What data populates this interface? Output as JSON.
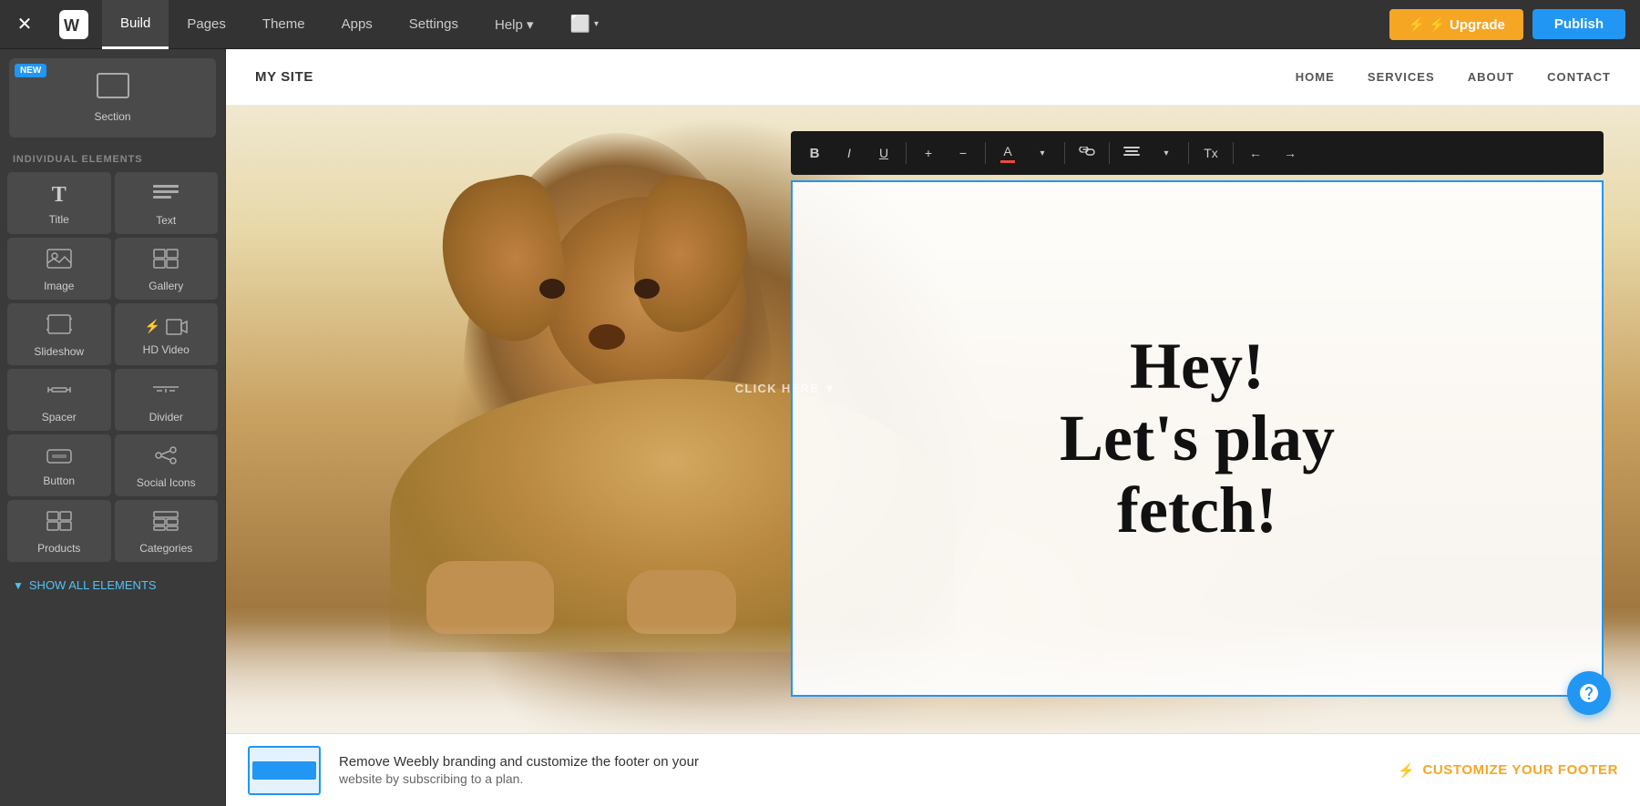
{
  "topbar": {
    "close_label": "×",
    "logo_alt": "Weebly Logo",
    "nav_items": [
      {
        "id": "build",
        "label": "Build",
        "active": true
      },
      {
        "id": "pages",
        "label": "Pages",
        "active": false
      },
      {
        "id": "theme",
        "label": "Theme",
        "active": false
      },
      {
        "id": "apps",
        "label": "Apps",
        "active": false
      },
      {
        "id": "settings",
        "label": "Settings",
        "active": false
      },
      {
        "id": "help",
        "label": "Help ▾",
        "active": false
      },
      {
        "id": "device",
        "label": "⬜ ▾",
        "active": false
      }
    ],
    "upgrade_label": "⚡ Upgrade",
    "publish_label": "Publish"
  },
  "sidebar": {
    "section_label": "Section",
    "new_badge": "NEW",
    "group_label": "INDIVIDUAL ELEMENTS",
    "elements": [
      {
        "id": "title",
        "label": "Title",
        "icon": "T"
      },
      {
        "id": "text",
        "label": "Text",
        "icon": "≡"
      },
      {
        "id": "image",
        "label": "Image",
        "icon": "🖼"
      },
      {
        "id": "gallery",
        "label": "Gallery",
        "icon": "⊞"
      },
      {
        "id": "slideshow",
        "label": "Slideshow",
        "icon": "▶"
      },
      {
        "id": "hd-video",
        "label": "HD Video",
        "icon": "▶",
        "lightning": true
      },
      {
        "id": "spacer",
        "label": "Spacer",
        "icon": "⇔"
      },
      {
        "id": "divider",
        "label": "Divider",
        "icon": "÷"
      },
      {
        "id": "button",
        "label": "Button",
        "icon": "▬"
      },
      {
        "id": "social-icons",
        "label": "Social Icons",
        "icon": "⋯"
      },
      {
        "id": "products",
        "label": "Products",
        "icon": "⊞"
      },
      {
        "id": "categories",
        "label": "Categories",
        "icon": "⊟"
      }
    ],
    "show_all_label": "SHOW ALL ELEMENTS"
  },
  "site_header": {
    "logo": "MY SITE",
    "nav_items": [
      {
        "label": "HOME"
      },
      {
        "label": "SERVICES"
      },
      {
        "label": "ABOUT"
      },
      {
        "label": "CONTACT"
      }
    ]
  },
  "hero": {
    "text_line1": "Hey!",
    "text_line2": "Let's play",
    "text_line3": "fetch!",
    "click_hint": "CLICK HERE ▼"
  },
  "toolbar": {
    "bold": "B",
    "italic": "I",
    "underline": "U",
    "add": "+",
    "subtract": "−",
    "color": "A",
    "link": "🔗",
    "align": "≡",
    "tx": "Tx",
    "undo": "←",
    "redo": "→"
  },
  "footer_banner": {
    "main_text": "Remove Weebly branding and customize the footer on your",
    "sub_text": "website by subscribing to a plan.",
    "customize_label": "CUSTOMIZE YOUR FOOTER"
  }
}
